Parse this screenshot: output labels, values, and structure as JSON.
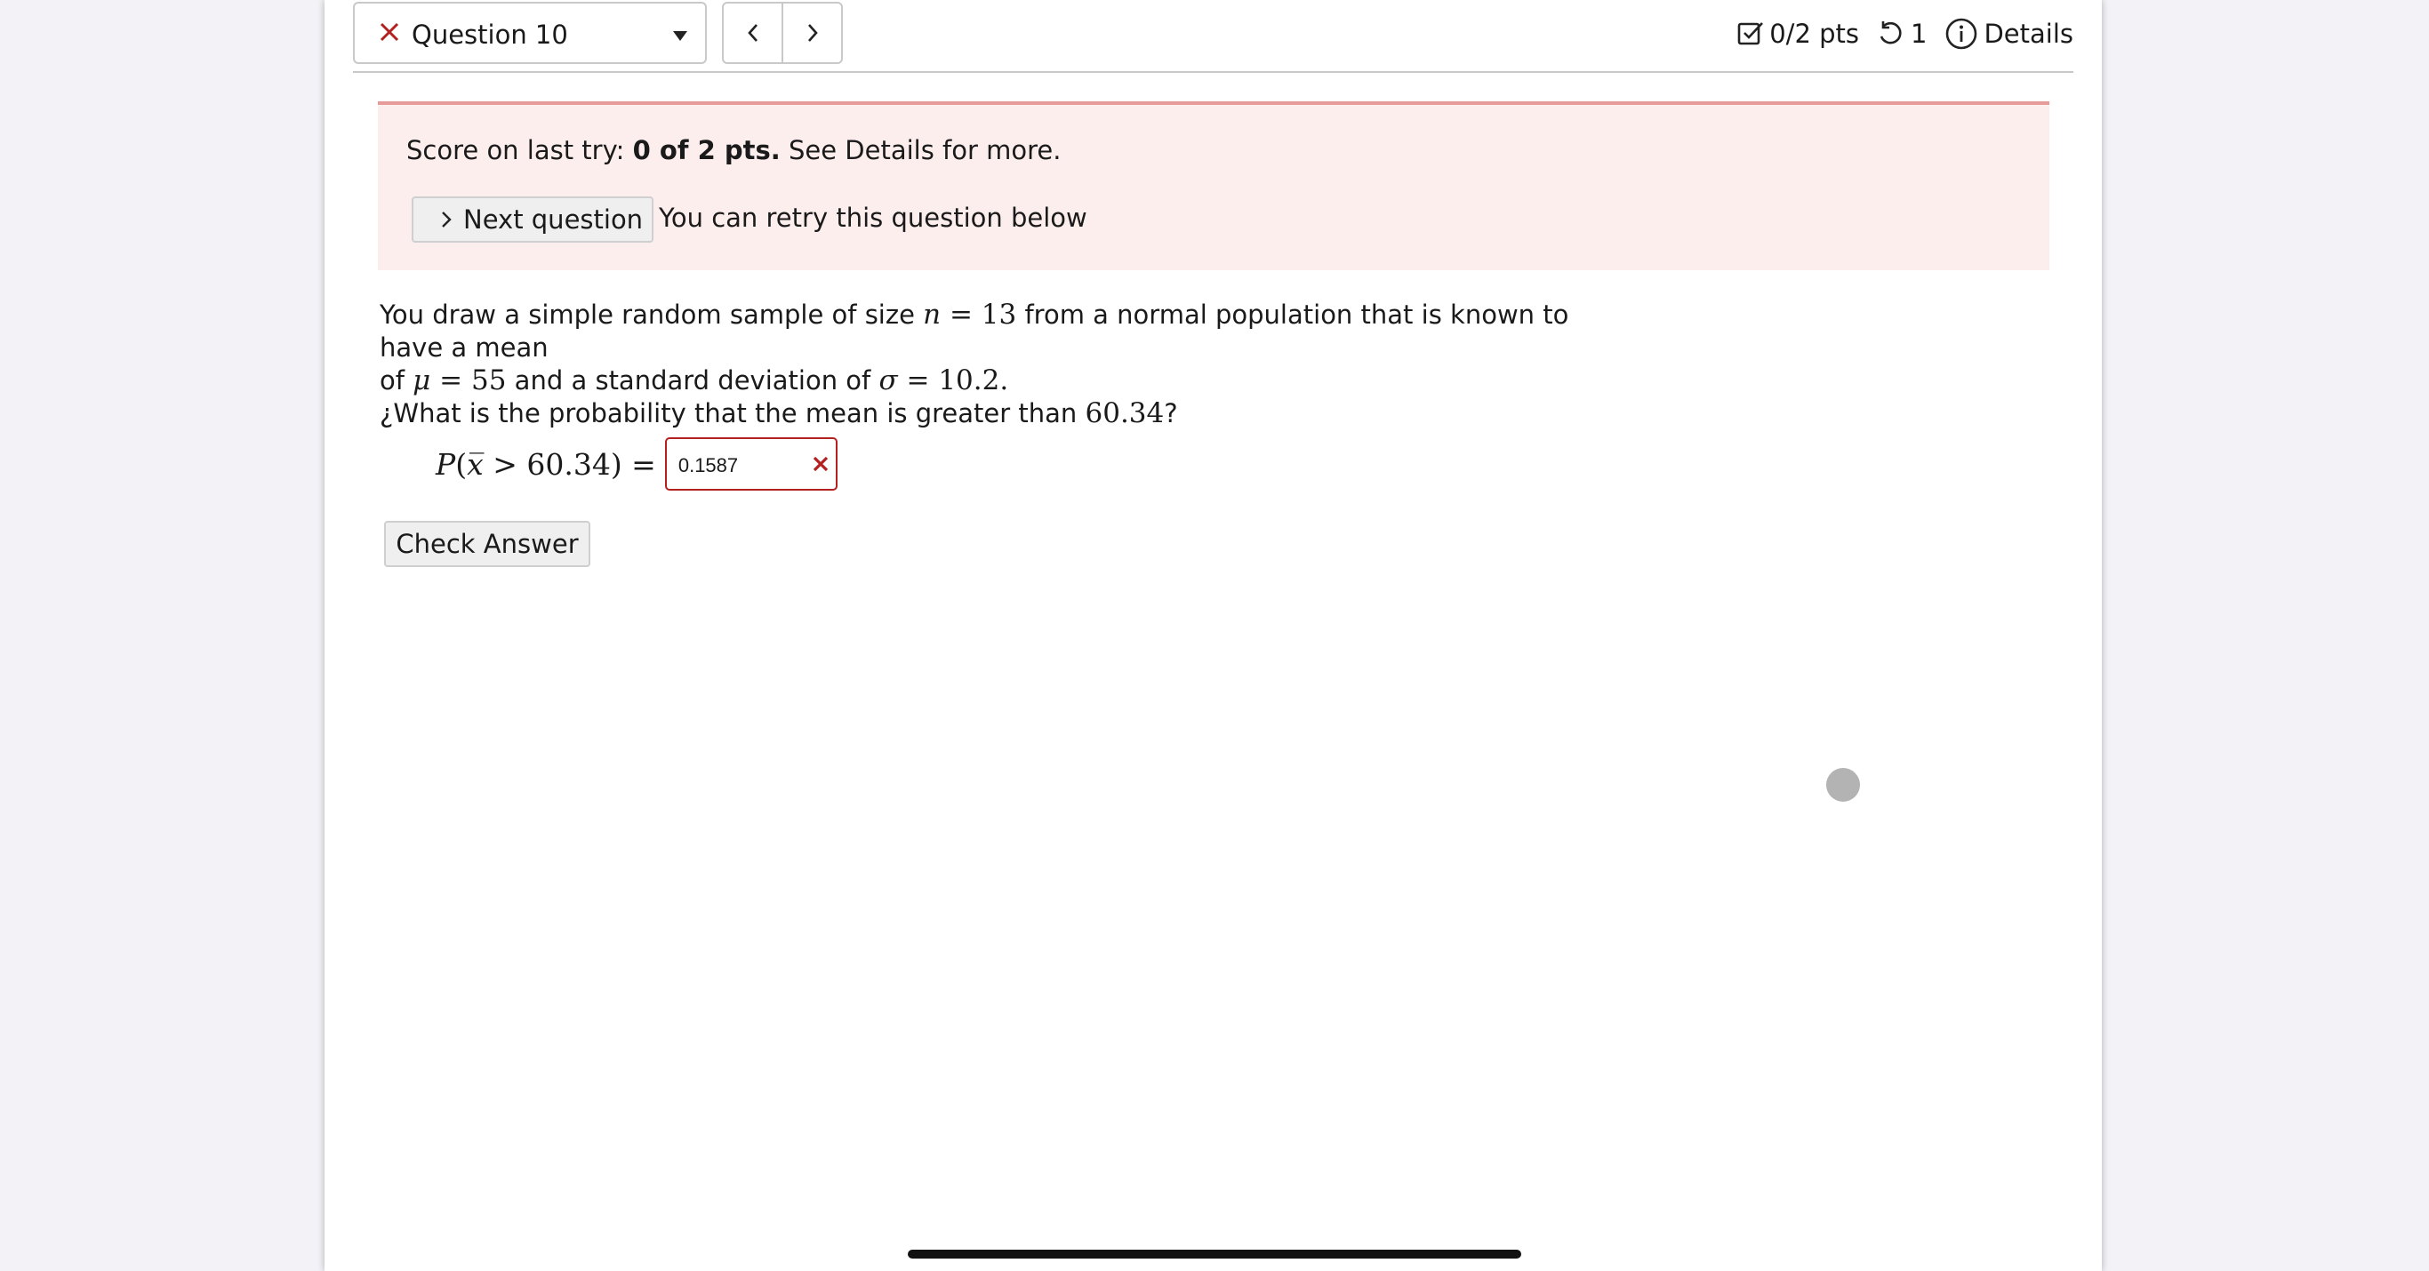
{
  "header": {
    "question_select": {
      "label": "Question 10",
      "status": "incorrect"
    },
    "prev_label": "‹",
    "next_label": "›",
    "points": "0/2 pts",
    "retries": "1",
    "details": "Details"
  },
  "feedback": {
    "score_prefix": "Score on last try: ",
    "score_value": "0 of 2 pts.",
    "score_suffix": " See Details for more.",
    "next_question": "Next question",
    "retry_note": "You can retry this question below"
  },
  "question": {
    "line1_a": "You draw a simple random sample of size ",
    "n_var": "n",
    "n_eq": " = 13",
    "line1_b": " from a normal population that is known to have a mean",
    "line2_a": "of ",
    "mu_var": "μ",
    "mu_eq": " = 55",
    "line2_b": " and a standard deviation of ",
    "sigma_var": "σ",
    "sigma_eq": " = 10.2",
    "line2_c": ".",
    "prompt_a": "¿What is the probability that the mean is greater than ",
    "prompt_val": "60.34",
    "prompt_b": "?",
    "expr_p": "P",
    "expr_open": "(",
    "expr_xbar": "x̅",
    "expr_rest": " > 60.34) =",
    "answer_value": "0.1587",
    "check_answer": "Check Answer"
  },
  "colors": {
    "error": "#b32020",
    "alert_bg": "#fdeeee",
    "alert_border": "#e79a9a"
  },
  "icons": [
    "close-icon",
    "caret-down-icon",
    "chevron-left-icon",
    "chevron-right-icon",
    "checkbox-icon",
    "retry-icon",
    "info-icon",
    "chevron-right-small-icon"
  ]
}
